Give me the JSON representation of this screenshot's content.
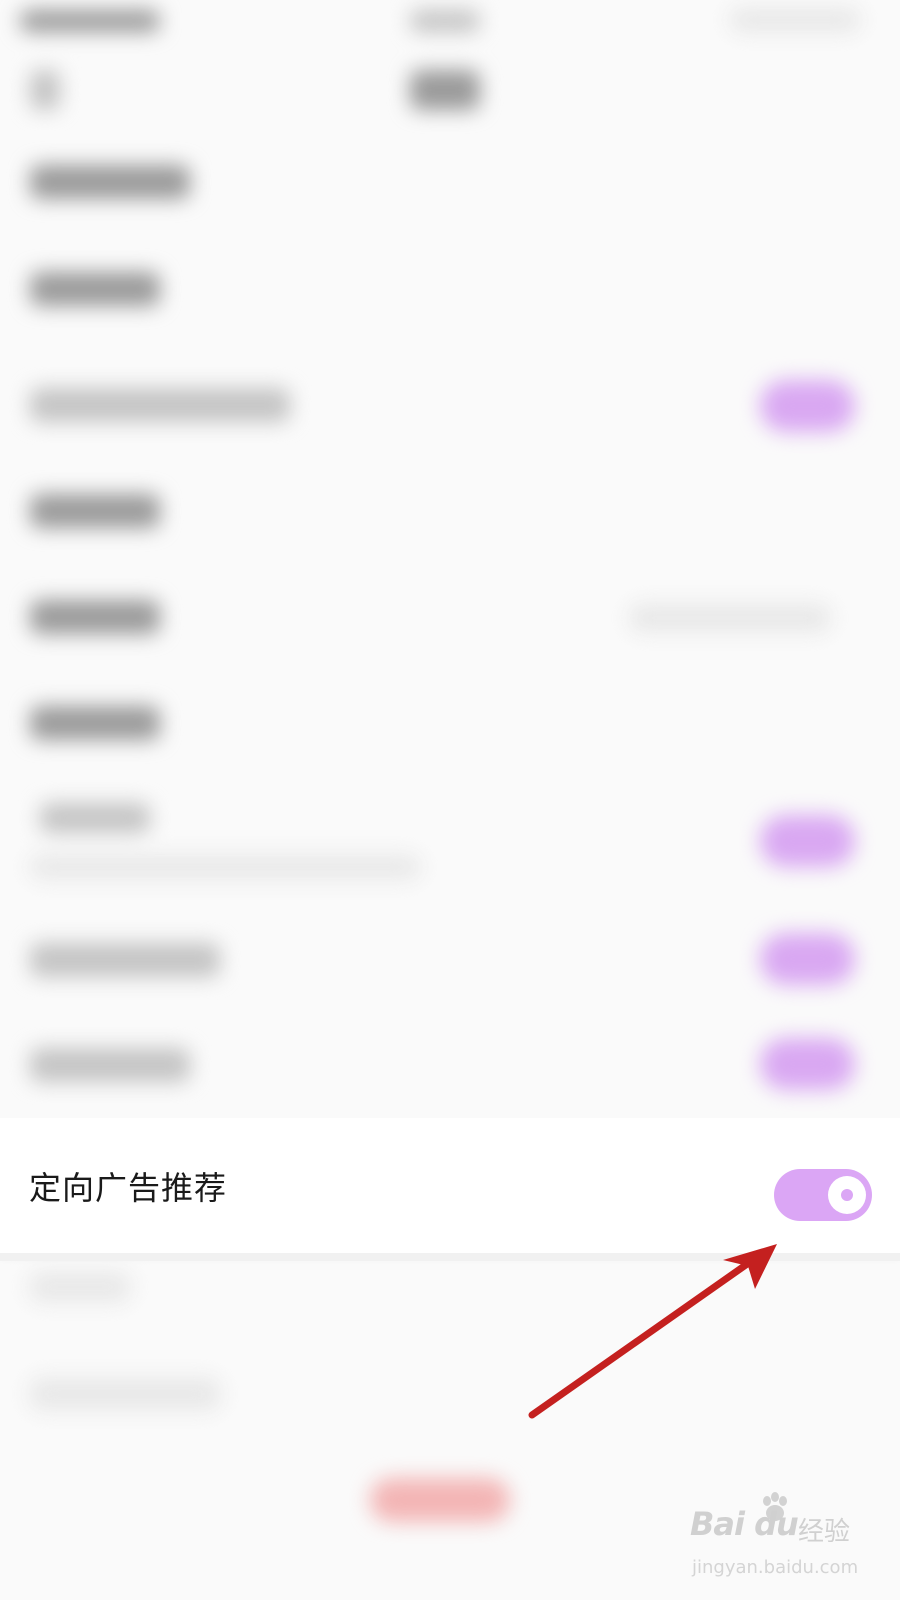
{
  "targeted_ad_row": {
    "label": "定向广告推荐",
    "toggle_on": true
  },
  "colors": {
    "toggle_accent": "#dba6f5",
    "arrow": "#c4201f",
    "background": "#fafafa"
  },
  "watermark": {
    "logo": "Bai du",
    "cn": "经验",
    "url": "jingyan.baidu.com"
  }
}
